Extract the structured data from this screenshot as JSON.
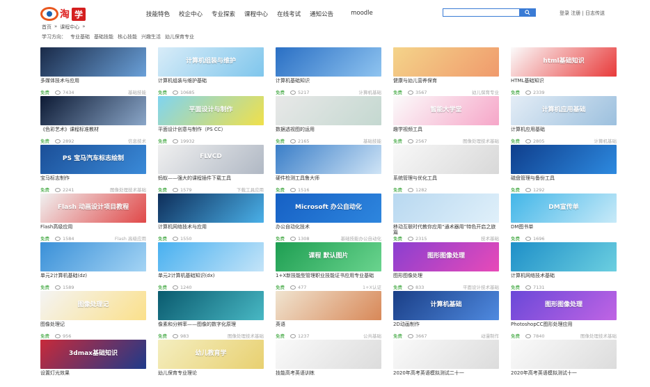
{
  "header": {
    "logo_mark": "淘",
    "logo_text": "淘",
    "logo_badge": "学",
    "nav": [
      "技能特色",
      "校企中心",
      "专业探索",
      "课程中心",
      "在线考试",
      "通知公告",
      "moodle"
    ],
    "user_links": "登录 注册 | 日志传送"
  },
  "breadcrumb": [
    "首页",
    "»",
    "课程中心",
    "»"
  ],
  "directions": {
    "label": "学习方向：",
    "items": [
      "专业基础",
      "基础技能",
      "核心技能",
      "兴趣生活",
      "幼儿保育专业"
    ]
  },
  "theme": {
    "accent": "#3a7bd5",
    "free": "#2a9d2a",
    "logo_red": "#d41e1e"
  },
  "courses": [
    {
      "title": "多媒体技术与应用",
      "views": "7434",
      "cat": "基础技能",
      "thumb_text": "",
      "bg": "linear-gradient(135deg,#1a2a48,#6aa0d8)"
    },
    {
      "title": "计算机组装与维护基础",
      "views": "10685",
      "cat": "",
      "thumb_text": "计算机组装与维护",
      "bg": "linear-gradient(135deg,#d8ecf8,#7fc6ec)"
    },
    {
      "title": "计算机基础知识",
      "views": "5217",
      "cat": "计算机基础",
      "thumb_text": "",
      "bg": "linear-gradient(135deg,#2a6fc4,#8fc4f0)"
    },
    {
      "title": "健康与幼儿营养保育",
      "views": "3567",
      "cat": "幼儿保育专业",
      "thumb_text": "",
      "bg": "linear-gradient(135deg,#f4d48a,#f09a6c)"
    },
    {
      "title": "HTML基础知识",
      "views": "2339",
      "cat": "",
      "thumb_text": "html基础知识",
      "bg": "linear-gradient(135deg,#fbfbfb,#e83a3a)"
    },
    {
      "title": "《色彩艺术》课程标准教材",
      "views": "2892",
      "cat": "信息技术",
      "thumb_text": "",
      "bg": "linear-gradient(135deg,#0d1a34,#8aa6c8)"
    },
    {
      "title": "平面设计创意与制作（PS CC）",
      "views": "19932",
      "cat": "",
      "thumb_text": "平面设计与制作",
      "bg": "linear-gradient(135deg,#7fd4f0,#f0e04a)"
    },
    {
      "title": "数据透视图的运用",
      "views": "2165",
      "cat": "基础技能",
      "thumb_text": "",
      "bg": "linear-gradient(135deg,#e8e8e8,#c4d8d0)"
    },
    {
      "title": "趣学视频工具",
      "views": "2567",
      "cat": "图像处理技术基础",
      "thumb_text": "智能大学堂",
      "bg": "linear-gradient(135deg,#fbfbfb,#f6a6c8)"
    },
    {
      "title": "计算机应用基础",
      "views": "2805",
      "cat": "计算机基础",
      "thumb_text": "计算机应用基础",
      "bg": "linear-gradient(135deg,#e4edf6,#9cc0de)"
    },
    {
      "title": "宝马标志制作",
      "views": "2241",
      "cat": "图像处理技术基础",
      "thumb_text": "PS 宝马汽车标志绘制",
      "bg": "linear-gradient(135deg,#1b4f98,#3a8ad8)"
    },
    {
      "title": "蚂蚁——强大的课程插件下载工具",
      "views": "1579",
      "cat": "下载工具应用",
      "thumb_text": "FLVCD",
      "bg": "linear-gradient(135deg,#f0f0f0,#b0b8c4)"
    },
    {
      "title": "硬件检测工具鲁大师",
      "views": "1516",
      "cat": "",
      "thumb_text": "",
      "bg": "linear-gradient(135deg,#3a7ec8,#cfe4f6)"
    },
    {
      "title": "系统管理与优化工具",
      "views": "1282",
      "cat": "",
      "thumb_text": "",
      "bg": "linear-gradient(135deg,#f8f8f8,#d8d8d8)"
    },
    {
      "title": "磁盘管理与备份工具",
      "views": "1292",
      "cat": "",
      "thumb_text": "",
      "bg": "linear-gradient(135deg,#0f3e8c,#2d8ae0)"
    },
    {
      "title": "Flash高级应用",
      "views": "1584",
      "cat": "Flash 高级应用",
      "thumb_text": "Flash 动画设计项目教程",
      "bg": "linear-gradient(135deg,#f0f0f0,#e04848)"
    },
    {
      "title": "计算机网络技术与应用",
      "views": "1550",
      "cat": "",
      "thumb_text": "",
      "bg": "linear-gradient(135deg,#0e2e5a,#4ab0e8)"
    },
    {
      "title": "办公自动化技术",
      "views": "1308",
      "cat": "基础技能办公自动化",
      "thumb_text": "Microsoft 办公自动化",
      "bg": "linear-gradient(135deg,#1660c4,#2e86de)"
    },
    {
      "title": "移动互联时代教你应用“通术器用”特色开启之旅篇",
      "views": "2315",
      "cat": "技术基础",
      "thumb_text": "",
      "bg": "linear-gradient(135deg,#b8d8f0,#e0f0fa)"
    },
    {
      "title": "DM图书单",
      "views": "1696",
      "cat": "",
      "thumb_text": "DM宣传单",
      "bg": "linear-gradient(135deg,#42b6e8,#c8eaf8)"
    },
    {
      "title": "单元2计算机基础(dz)",
      "views": "1589",
      "cat": "",
      "thumb_text": "",
      "bg": "linear-gradient(135deg,#3a90d8,#a4d4f4)"
    },
    {
      "title": "单元2计算机基础知识(dx)",
      "views": "1240",
      "cat": "",
      "thumb_text": "",
      "bg": "linear-gradient(135deg,#48b0f0,#c4e4f8)"
    },
    {
      "title": "1+X新技能型管理职业技能证书应用专业基础",
      "views": "477",
      "cat": "1+X认证",
      "thumb_text": "课程 默认图片",
      "bg": "linear-gradient(135deg,#1e9e52,#6ad48e)"
    },
    {
      "title": "图形图像处理",
      "views": "833",
      "cat": "平面设计技术基础",
      "thumb_text": "图形图像处理",
      "bg": "linear-gradient(135deg,#8a3fd0,#e84ab8)"
    },
    {
      "title": "计算机网络技术基础",
      "views": "7131",
      "cat": "",
      "thumb_text": "",
      "bg": "linear-gradient(135deg,#1e8fc8,#6ccfe0)"
    },
    {
      "title": "图像处理记",
      "views": "956",
      "cat": "",
      "thumb_text": "图像处理记",
      "bg": "linear-gradient(135deg,#f4f4f4,#fbe08a)"
    },
    {
      "title": "像素和分辨率——图像的数字化原理",
      "views": "983",
      "cat": "图像处理技术基础",
      "thumb_text": "",
      "bg": "linear-gradient(135deg,#0a5a6e,#48b8c4)"
    },
    {
      "title": "英语",
      "views": "1237",
      "cat": "公共基础",
      "thumb_text": "",
      "bg": "linear-gradient(135deg,#f0e4d0,#d88858)"
    },
    {
      "title": "2D动画制作",
      "views": "3667",
      "cat": "动漫制作",
      "thumb_text": "计算机基础",
      "bg": "linear-gradient(135deg,#1a3e86,#4f8ae0)"
    },
    {
      "title": "PhotoshopCC图形处理应用",
      "views": "7840",
      "cat": "图像处理技术基础",
      "thumb_text": "图形图像处理",
      "bg": "linear-gradient(135deg,#6a48d8,#c064e4)"
    },
    {
      "title": "设置灯光效果",
      "views": "",
      "cat": "",
      "thumb_text": "3dmax基础知识",
      "bg": "linear-gradient(135deg,#c82a3a,#1e3a8a)"
    },
    {
      "title": "幼儿保育专业理论",
      "views": "",
      "cat": "",
      "thumb_text": "幼儿教育学",
      "bg": "linear-gradient(135deg,#f4eec0,#e8d070)"
    },
    {
      "title": "技能高考英语训练",
      "views": "",
      "cat": "",
      "thumb_text": "",
      "bg": "linear-gradient(135deg,#fafafa,#dcdcdc)"
    },
    {
      "title": "2020年高考英语模拟测试二十一",
      "views": "",
      "cat": "",
      "thumb_text": "",
      "bg": "linear-gradient(135deg,#fafafa,#dcdcdc)"
    },
    {
      "title": "2020年高考英语模拟测试十一",
      "views": "",
      "cat": "",
      "thumb_text": "",
      "bg": "linear-gradient(135deg,#fafafa,#dcdcdc)"
    }
  ],
  "free_label": "免费"
}
